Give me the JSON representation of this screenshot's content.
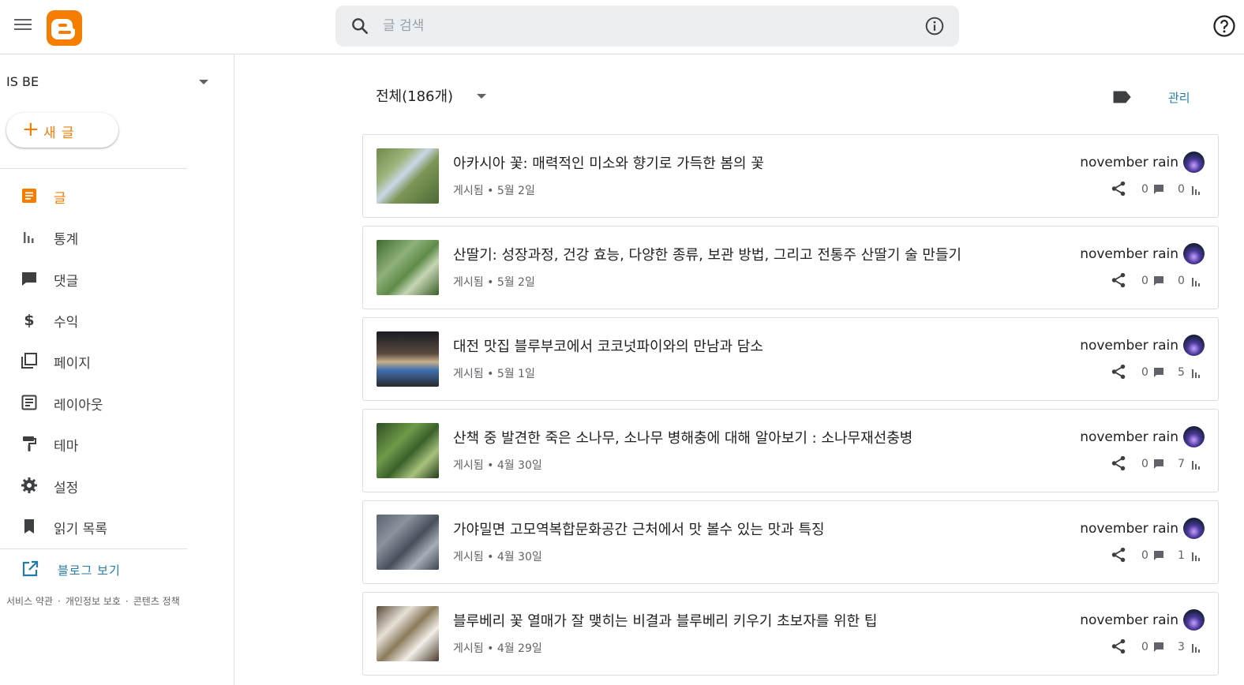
{
  "header": {
    "search_placeholder": "글 검색"
  },
  "sidebar": {
    "blog_name": "IS BE",
    "new_post_label": "새 글",
    "items": [
      {
        "label": "글",
        "icon": "posts-icon",
        "active": true
      },
      {
        "label": "통계",
        "icon": "stats-icon",
        "active": false
      },
      {
        "label": "댓글",
        "icon": "comments-icon",
        "active": false
      },
      {
        "label": "수익",
        "icon": "earnings-icon",
        "active": false
      },
      {
        "label": "페이지",
        "icon": "pages-icon",
        "active": false
      },
      {
        "label": "레이아웃",
        "icon": "layout-icon",
        "active": false
      },
      {
        "label": "테마",
        "icon": "theme-icon",
        "active": false
      },
      {
        "label": "설정",
        "icon": "settings-icon",
        "active": false
      },
      {
        "label": "읽기 목록",
        "icon": "reading-list-icon",
        "active": false
      }
    ],
    "view_blog_label": "블로그 보기",
    "footer_links": [
      "서비스 약관",
      "개인정보 보호",
      "콘텐츠 정책"
    ]
  },
  "main": {
    "filter_label": "전체(186개)",
    "manage_label": "관리",
    "posts": [
      {
        "title": "아카시아 꽃: 매력적인 미소와 향기로 가득한 봄의 꽃",
        "status": "게시됨",
        "date": "5월 2일",
        "author": "november rain",
        "comments": "0",
        "views": "0"
      },
      {
        "title": "산딸기: 성장과정, 건강 효능, 다양한 종류, 보관 방법, 그리고 전통주 산딸기 술 만들기",
        "status": "게시됨",
        "date": "5월 2일",
        "author": "november rain",
        "comments": "0",
        "views": "0"
      },
      {
        "title": "대전 맛집 블루부코에서 코코넛파이와의 만남과 담소",
        "status": "게시됨",
        "date": "5월 1일",
        "author": "november rain",
        "comments": "0",
        "views": "5"
      },
      {
        "title": "산책 중 발견한 죽은 소나무, 소나무 병해충에 대해 알아보기 : 소나무재선충병",
        "status": "게시됨",
        "date": "4월 30일",
        "author": "november rain",
        "comments": "0",
        "views": "7"
      },
      {
        "title": "가야밀면 고모역복합문화공간 근처에서 맛 볼수 있는 맛과 특징",
        "status": "게시됨",
        "date": "4월 30일",
        "author": "november rain",
        "comments": "0",
        "views": "1"
      },
      {
        "title": "블루베리 꽃 열매가 잘 맺히는 비결과 블루베리 키우기 초보자를 위한 팁",
        "status": "게시됨",
        "date": "4월 29일",
        "author": "november rain",
        "comments": "0",
        "views": "3"
      }
    ]
  },
  "colors": {
    "accent": "#f57d00",
    "link": "#1f7ba8",
    "text": "#202124",
    "muted": "#5f6368",
    "border": "#dadce0"
  }
}
